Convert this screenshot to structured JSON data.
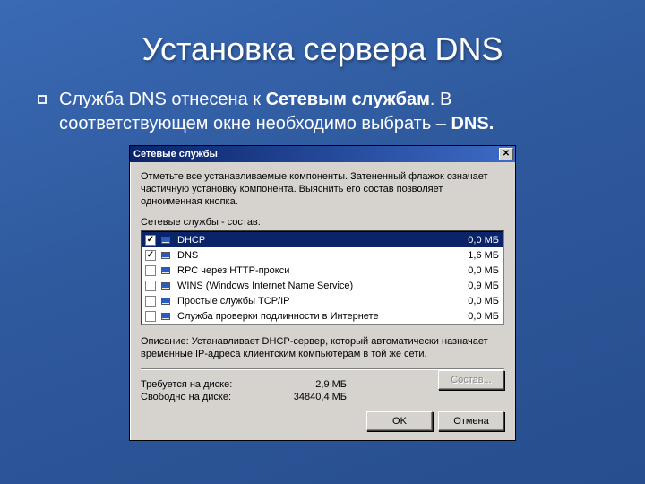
{
  "slide": {
    "title": "Установка сервера DNS",
    "bullet_pre": "Служба DNS отнесена к ",
    "bullet_b1": "Сетевым службам",
    "bullet_mid": ". В соответствующем окне необходимо выбрать – ",
    "bullet_b2": "DNS."
  },
  "dialog": {
    "title": "Сетевые службы",
    "close_glyph": "✕",
    "intro": "Отметьте все устанавливаемые компоненты. Затененный флажок означает частичную установку компонента. Выяснить его состав позволяет одноименная кнопка.",
    "list_label": "Сетевые службы - состав:",
    "items": [
      {
        "checked": true,
        "selected": true,
        "label": "DHCP",
        "size": "0,0 МБ"
      },
      {
        "checked": true,
        "selected": false,
        "label": "DNS",
        "size": "1,6 МБ"
      },
      {
        "checked": false,
        "selected": false,
        "label": "RPC через HTTP-прокси",
        "size": "0,0 МБ"
      },
      {
        "checked": false,
        "selected": false,
        "label": "WINS (Windows Internet Name Service)",
        "size": "0,9 МБ"
      },
      {
        "checked": false,
        "selected": false,
        "label": "Простые службы TCP/IP",
        "size": "0,0 МБ"
      },
      {
        "checked": false,
        "selected": false,
        "label": "Служба проверки подлинности в Интернете",
        "size": "0,0 МБ"
      }
    ],
    "desc_label": "Описание:",
    "desc_text": "Устанавливает DHCP-сервер, который автоматически назначает временные IP-адреса клиентским компьютерам в той же сети.",
    "req_label": "Требуется на диске:",
    "req_value": "2,9 МБ",
    "free_label": "Свободно на диске:",
    "free_value": "34840,4 МБ",
    "btn_compose": "Состав...",
    "btn_ok": "OK",
    "btn_cancel": "Отмена"
  }
}
